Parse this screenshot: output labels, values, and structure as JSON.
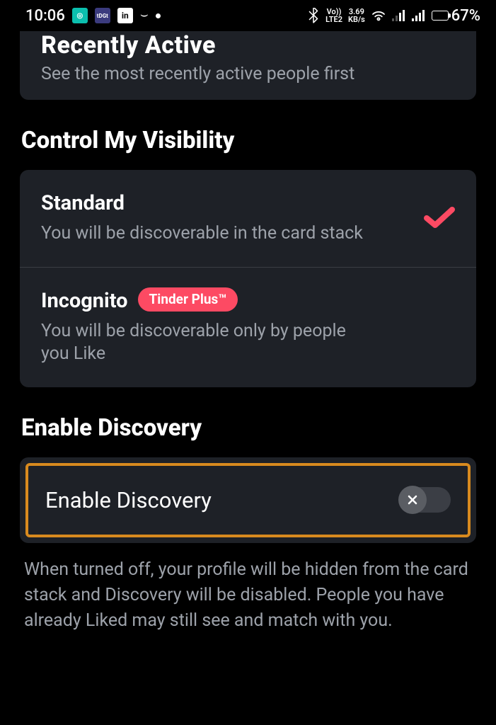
{
  "status_bar": {
    "time": "10:06",
    "bt_icon": "bluetooth",
    "net1_top": "Vo))",
    "net1_bot": "LTE2",
    "net2_top": "3.69",
    "net2_bot": "KB/s",
    "battery_pct": "67%",
    "battery_fill_pct": 67
  },
  "recently": {
    "title": "Recently Active",
    "desc": "See the most recently active people first"
  },
  "visibility": {
    "section_title": "Control My Visibility",
    "standard": {
      "title": "Standard",
      "desc": "You will be discoverable in the card stack",
      "selected": true
    },
    "incognito": {
      "title": "Incognito",
      "badge": "Tinder Plus™",
      "desc": "You will be discoverable only by people you Like"
    }
  },
  "discovery": {
    "section_title": "Enable Discovery",
    "row_label": "Enable Discovery",
    "enabled": false,
    "footer": "When turned off, your profile will be hidden from the card stack and Discovery will be disabled. People you have already Liked may still see and match with you."
  }
}
